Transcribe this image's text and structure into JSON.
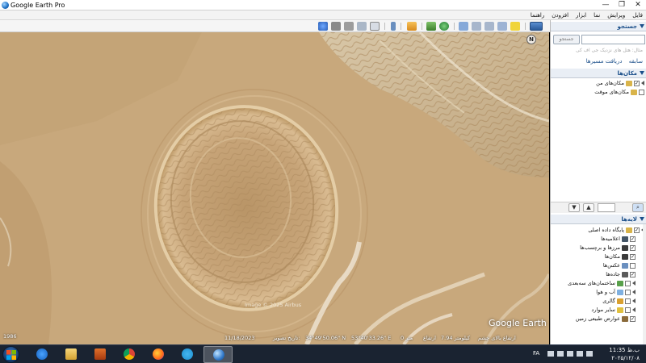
{
  "window": {
    "title": "Google Earth Pro",
    "controls": {
      "minimize": "—",
      "maximize": "❐",
      "close": "✕"
    }
  },
  "menubar": {
    "items": [
      "فایل",
      "ویرایش",
      "نما",
      "ابزار",
      "افزودن",
      "راهنما"
    ]
  },
  "toolbar": {
    "icons": [
      "sidebar-toggle-icon",
      "add-placemark-icon",
      "add-polygon-icon",
      "add-path-icon",
      "add-image-overlay-icon",
      "record-tour-icon",
      "historical-imagery-icon",
      "sunlight-icon",
      "planets-icon",
      "ruler-icon",
      "email-icon",
      "print-icon",
      "save-image-icon",
      "view-in-maps-icon"
    ]
  },
  "map": {
    "copyright": "Image © 2025 Airbus",
    "brand": "Google Earth",
    "north_label": "N",
    "year": "1986",
    "status": {
      "imagery_date_label": "تاریخ تصویر:",
      "imagery_date": "11/18/2023",
      "latitude": "34°49'50.06\" N",
      "longitude": "53°40'33.26\" E",
      "elevation_label": "ارتفاع",
      "elevation": "0 متر",
      "eye_alt_label": "ارتفاع بالای چشم",
      "eye_alt": "7.94 کیلومتر"
    }
  },
  "sidebar": {
    "search": {
      "header": "جستجو",
      "placeholder": "",
      "button": "جستجو",
      "hint": "مثال: هتل های نزدیک جی اف کی",
      "links": [
        "دریافت مسیرها",
        "سابقه"
      ]
    },
    "places": {
      "header": "مکان‌ها",
      "items": [
        {
          "label": "مکان‌های من",
          "checked": true
        },
        {
          "label": "مکان‌های موقت",
          "checked": false
        }
      ]
    },
    "layers": {
      "header": "لایه‌ها",
      "items": [
        {
          "label": "پایگاه داده اصلی",
          "checked": true,
          "color": "#d9b44a"
        },
        {
          "label": "اعلامیه‌ها",
          "checked": true,
          "color": "#445566"
        },
        {
          "label": "مرزها و برچسب‌ها",
          "checked": true,
          "color": "#3a3a3a"
        },
        {
          "label": "مکان‌ها",
          "checked": true,
          "color": "#3a3a3a"
        },
        {
          "label": "عکس‌ها",
          "checked": false,
          "color": "#6a8fbf"
        },
        {
          "label": "جاده‌ها",
          "checked": true,
          "color": "#5a5a5a"
        },
        {
          "label": "ساختمان‌های سه‌بعدی",
          "checked": false,
          "color": "#58a04a"
        },
        {
          "label": "آب و هوا",
          "checked": false,
          "color": "#7fb0e0"
        },
        {
          "label": "گالری",
          "checked": false,
          "color": "#d9a030"
        },
        {
          "label": "سایر موارد",
          "checked": false,
          "color": "#e0c040"
        },
        {
          "label": "عوارض طبیعی زمین",
          "checked": true,
          "color": "#8a6a3a"
        }
      ]
    }
  },
  "taskbar": {
    "apps": [
      "internet-explorer-icon",
      "file-explorer-icon",
      "media-player-icon",
      "chrome-icon",
      "firefox-icon",
      "telegram-icon",
      "google-earth-icon"
    ],
    "language": "FA",
    "time": "11:35 ب.ظ",
    "date": "۲۰۲۵/۱۲/۰۸"
  }
}
